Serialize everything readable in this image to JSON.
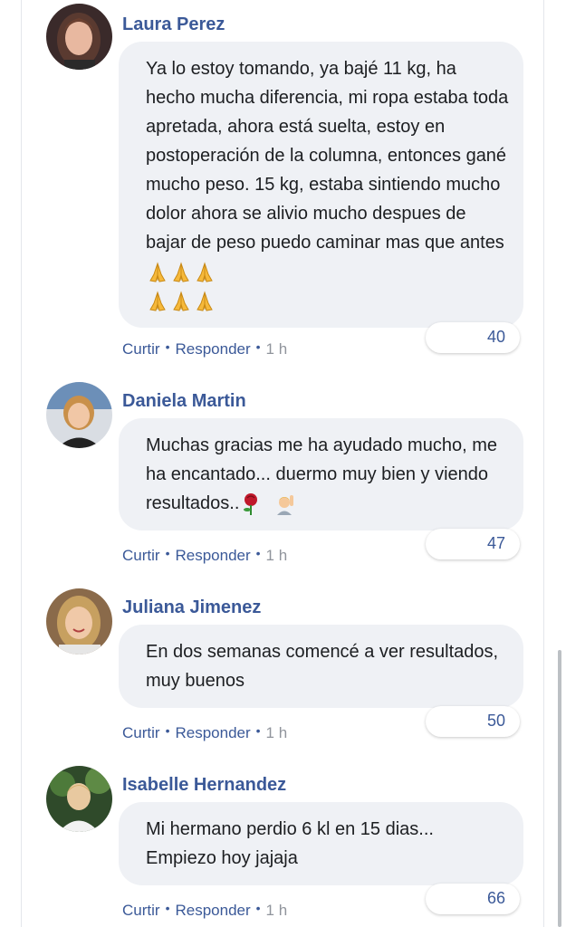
{
  "comments": [
    {
      "author": "Laura Perez",
      "text": "Ya lo estoy tomando, ya bajé 11 kg, ha hecho mucha diferencia, mi ropa estaba toda apretada, ahora está suelta, estoy en postoperación de la columna, entonces gané mucho peso. 15 kg, estaba sintiendo mucho dolor ahora se alivio mucho despues de bajar de peso puedo caminar mas que antes",
      "emojis": [
        "folded-hands",
        "folded-hands",
        "folded-hands",
        "folded-hands",
        "folded-hands",
        "folded-hands"
      ],
      "like_label": "Curtir",
      "reply_label": "Responder",
      "time": "1 h",
      "reaction_count": "40"
    },
    {
      "author": "Daniela Martin",
      "text": "Muchas gracias me ha ayudado mucho, me ha encantado... duermo muy bien y viendo resultados..",
      "emojis": [
        "rose",
        "person-raising-hand"
      ],
      "like_label": "Curtir",
      "reply_label": "Responder",
      "time": "1 h",
      "reaction_count": "47"
    },
    {
      "author": "Juliana Jimenez",
      "text": "En dos semanas comencé a ver resultados, muy buenos",
      "like_label": "Curtir",
      "reply_label": "Responder",
      "time": "1 h",
      "reaction_count": "50"
    },
    {
      "author": "Isabelle Hernandez",
      "text": "Mi hermano perdio 6 kl en 15 dias... Empiezo hoy jajaja",
      "like_label": "Curtir",
      "reply_label": "Responder",
      "time": "1 h",
      "reaction_count": "66"
    }
  ],
  "colors": {
    "link": "#3b5998",
    "bubble": "#eff1f5",
    "text": "#1c1e21",
    "muted": "#90949c"
  }
}
